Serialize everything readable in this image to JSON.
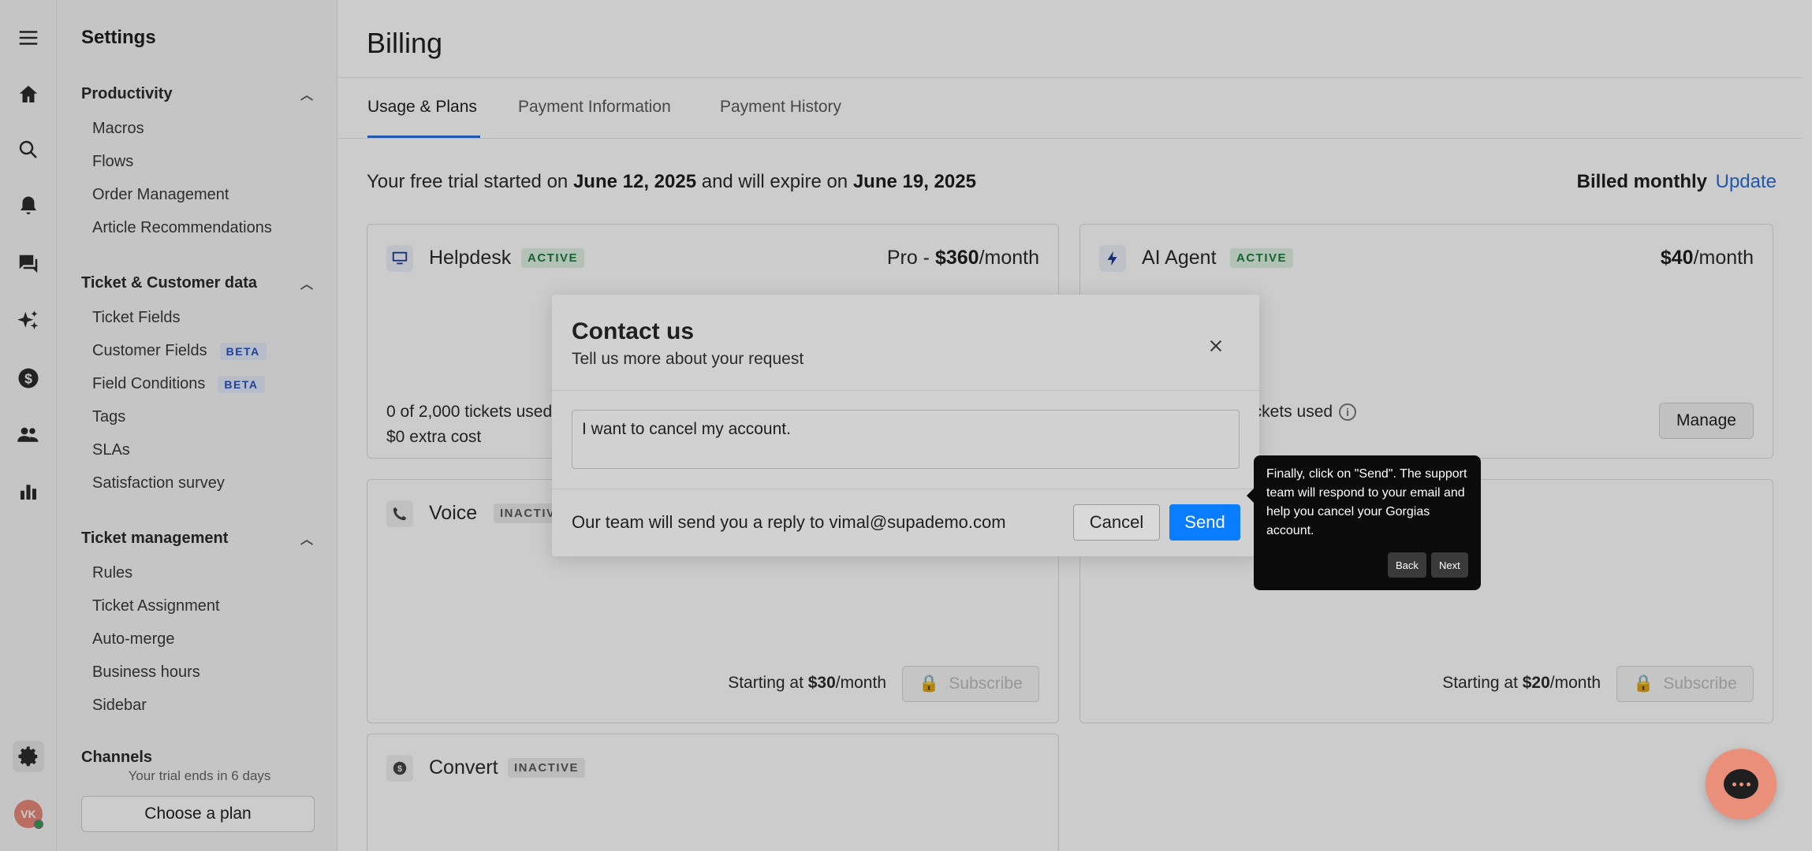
{
  "sidebar": {
    "title": "Settings",
    "sections": [
      {
        "label": "Productivity",
        "items": [
          {
            "label": "Macros"
          },
          {
            "label": "Flows"
          },
          {
            "label": "Order Management"
          },
          {
            "label": "Article Recommendations"
          }
        ]
      },
      {
        "label": "Ticket & Customer data",
        "items": [
          {
            "label": "Ticket Fields"
          },
          {
            "label": "Customer Fields",
            "badge": "BETA"
          },
          {
            "label": "Field Conditions",
            "badge": "BETA"
          },
          {
            "label": "Tags"
          },
          {
            "label": "SLAs"
          },
          {
            "label": "Satisfaction survey"
          }
        ]
      },
      {
        "label": "Ticket management",
        "items": [
          {
            "label": "Rules"
          },
          {
            "label": "Ticket Assignment"
          },
          {
            "label": "Auto-merge"
          },
          {
            "label": "Business hours"
          },
          {
            "label": "Sidebar"
          }
        ]
      },
      {
        "label": "Channels"
      }
    ],
    "trial_text": "Your trial ends in 6 days",
    "choose_plan": "Choose a plan",
    "avatar_initials": "VK"
  },
  "main": {
    "title": "Billing",
    "tabs": [
      {
        "label": "Usage & Plans"
      },
      {
        "label": "Payment Information"
      },
      {
        "label": "Payment History"
      }
    ],
    "trial": {
      "prefix": "Your free trial started on ",
      "start": "June 12, 2025",
      "middle": " and will expire on ",
      "end": "June 19, 2025"
    },
    "billed": "Billed monthly",
    "update": "Update",
    "cards": {
      "helpdesk": {
        "name": "Helpdesk",
        "status": "ACTIVE",
        "price_prefix": "Pro - ",
        "price": "$360",
        "price_suffix": "/month",
        "usage": "0 of 2,000 tickets used",
        "extra": "$0 extra cost"
      },
      "ai_agent": {
        "name": "AI Agent",
        "status": "ACTIVE",
        "price": "$40",
        "price_suffix": "/month",
        "usage": "ickets used",
        "manage": "Manage"
      },
      "voice": {
        "name": "Voice",
        "status": "INACTIVE",
        "start_prefix": "Starting at ",
        "start_price": "$30",
        "start_suffix": "/month",
        "subscribe": "Subscribe"
      },
      "sms": {
        "start_prefix": "Starting at ",
        "start_price": "$20",
        "start_suffix": "/month",
        "subscribe": "Subscribe"
      },
      "convert": {
        "name": "Convert",
        "status": "INACTIVE"
      }
    }
  },
  "modal": {
    "title": "Contact us",
    "subtitle": "Tell us more about your request",
    "message": "I want to cancel my account.",
    "footer_text": "Our team will send you a reply to vimal@supademo.com",
    "cancel": "Cancel",
    "send": "Send"
  },
  "tooltip": {
    "text": "Finally, click on \"Send\". The support team will respond to your email and help you cancel your Gorgias account.",
    "back": "Back",
    "next": "Next"
  }
}
